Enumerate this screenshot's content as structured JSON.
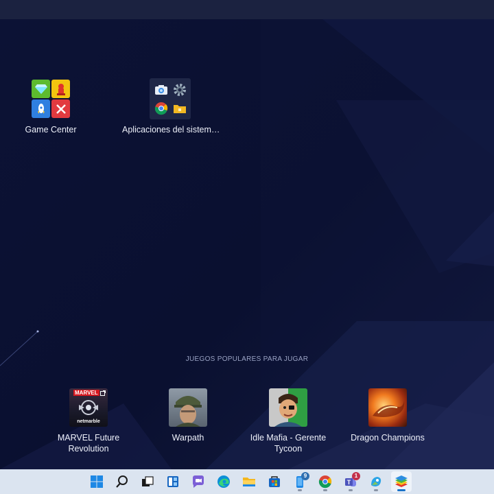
{
  "desktop": {
    "icons": [
      {
        "label": "Game Center",
        "icon": "game-center-icon"
      },
      {
        "label": "Aplicaciones del sistem…",
        "icon": "system-apps-folder-icon"
      }
    ]
  },
  "popular": {
    "title": "JUEGOS POPULARES PARA JUGAR",
    "games": [
      {
        "label": "MARVEL Future Revolution",
        "icon": "marvel-future-revolution-icon",
        "badge_text": "MARVEL",
        "sub_text": "netmarble"
      },
      {
        "label": "Warpath",
        "icon": "warpath-icon"
      },
      {
        "label": "Idle Mafia - Gerente Tycoon",
        "icon": "idle-mafia-icon"
      },
      {
        "label": "Dragon Champions",
        "icon": "dragon-champions-icon"
      }
    ]
  },
  "taskbar": {
    "items": [
      {
        "name": "windows-start",
        "icon": "windows-logo-icon"
      },
      {
        "name": "search",
        "icon": "search-icon"
      },
      {
        "name": "task-view",
        "icon": "task-view-icon"
      },
      {
        "name": "widgets",
        "icon": "widgets-icon"
      },
      {
        "name": "chat",
        "icon": "chat-icon"
      },
      {
        "name": "edge",
        "icon": "edge-browser-icon"
      },
      {
        "name": "file-explorer",
        "icon": "folder-icon"
      },
      {
        "name": "store",
        "icon": "store-icon"
      },
      {
        "name": "phone-link",
        "icon": "phone-icon",
        "badge": "9"
      },
      {
        "name": "chrome",
        "icon": "chrome-icon"
      },
      {
        "name": "teams",
        "icon": "teams-icon",
        "badge": "1"
      },
      {
        "name": "photos",
        "icon": "photos-icon"
      },
      {
        "name": "bluestacks",
        "icon": "bluestacks-icon",
        "active": true
      }
    ]
  },
  "colors": {
    "background": "#0b1130",
    "topbar": "#1b2240",
    "taskbar": "#dbe4f0",
    "accent": "#1a73c8"
  }
}
